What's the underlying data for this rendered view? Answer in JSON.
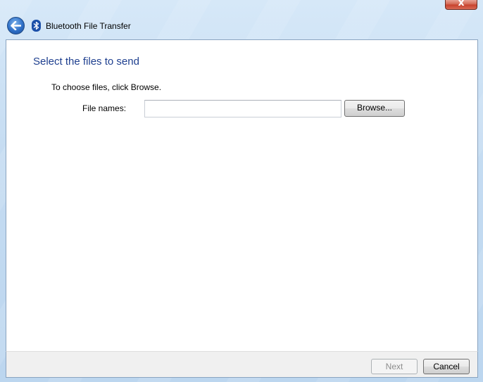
{
  "window": {
    "title": "Bluetooth File Transfer",
    "close_glyph": "x"
  },
  "icons": {
    "back": "back-arrow-icon",
    "bluetooth": "bluetooth-icon",
    "close": "close-icon"
  },
  "page": {
    "heading": "Select the files to send",
    "instruction": "To choose files, click Browse.",
    "file_names_label": "File names:",
    "file_names_value": "",
    "browse_label": "Browse..."
  },
  "footer": {
    "next_label": "Next",
    "cancel_label": "Cancel"
  },
  "colors": {
    "heading": "#1e3f8f",
    "disabled_text": "#8d8d8d",
    "close_button": "#c7402b"
  }
}
